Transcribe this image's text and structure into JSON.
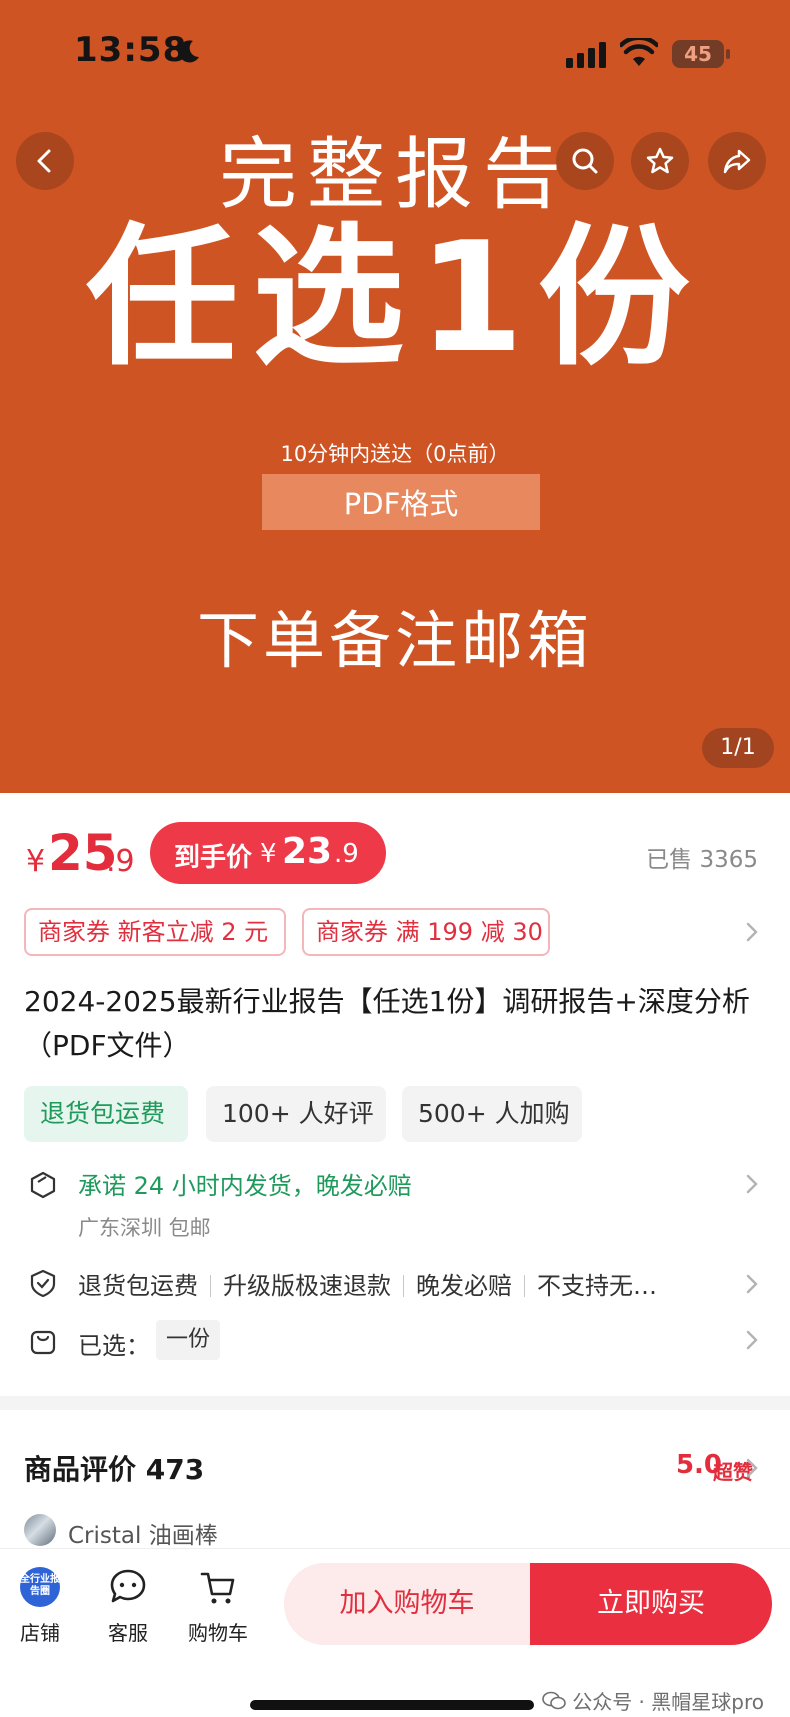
{
  "status_bar": {
    "time": "13:58",
    "battery": "45"
  },
  "hero": {
    "title_line1": "完整报告",
    "title_line2": "任选1份",
    "delivery_note": "10分钟内送达（0点前）",
    "format": "PDF格式",
    "order_note": "下单备注邮箱",
    "page_indicator": "1/1",
    "bg_color": "#cf5424"
  },
  "nav_icons": {
    "back": "back-arrow-icon",
    "search": "search-icon",
    "favorite": "star-icon",
    "share": "share-icon"
  },
  "price": {
    "symbol": "¥",
    "integer": "25",
    "decimal": ".9",
    "final_label": "到手价",
    "final_symbol": "¥",
    "final_integer": "23",
    "final_decimal": ".9",
    "sold": "已售 3365",
    "accent_color": "#e32d3c"
  },
  "coupons": [
    "商家券 新客立减 2 元",
    "商家券 满 199 减 30"
  ],
  "product_title": "2024-2025最新行业报告【任选1份】调研报告+深度分析（PDF文件）",
  "tags": [
    "退货包运费",
    "100+ 人好评",
    "500+ 人加购"
  ],
  "shipping": {
    "promise": "承诺 24 小时内发货，晚发必赔",
    "origin": "广东深圳 包邮"
  },
  "guarantees": [
    "退货包运费",
    "升级版极速退款",
    "晚发必赔",
    "不支持无…"
  ],
  "selection": {
    "label": "已选：",
    "value": "一份"
  },
  "reviews": {
    "title": "商品评价 473",
    "score": "5.0",
    "score_label": "超赞",
    "reviewer_name": "Cristal 油画棒"
  },
  "bottom_bar": {
    "store_logo_text": "全行业报告圈",
    "store": "店铺",
    "customer_service": "客服",
    "cart": "购物车",
    "add_to_cart": "加入购物车",
    "buy_now": "立即购买"
  },
  "watermark": "公众号 · 黑帽星球pro"
}
